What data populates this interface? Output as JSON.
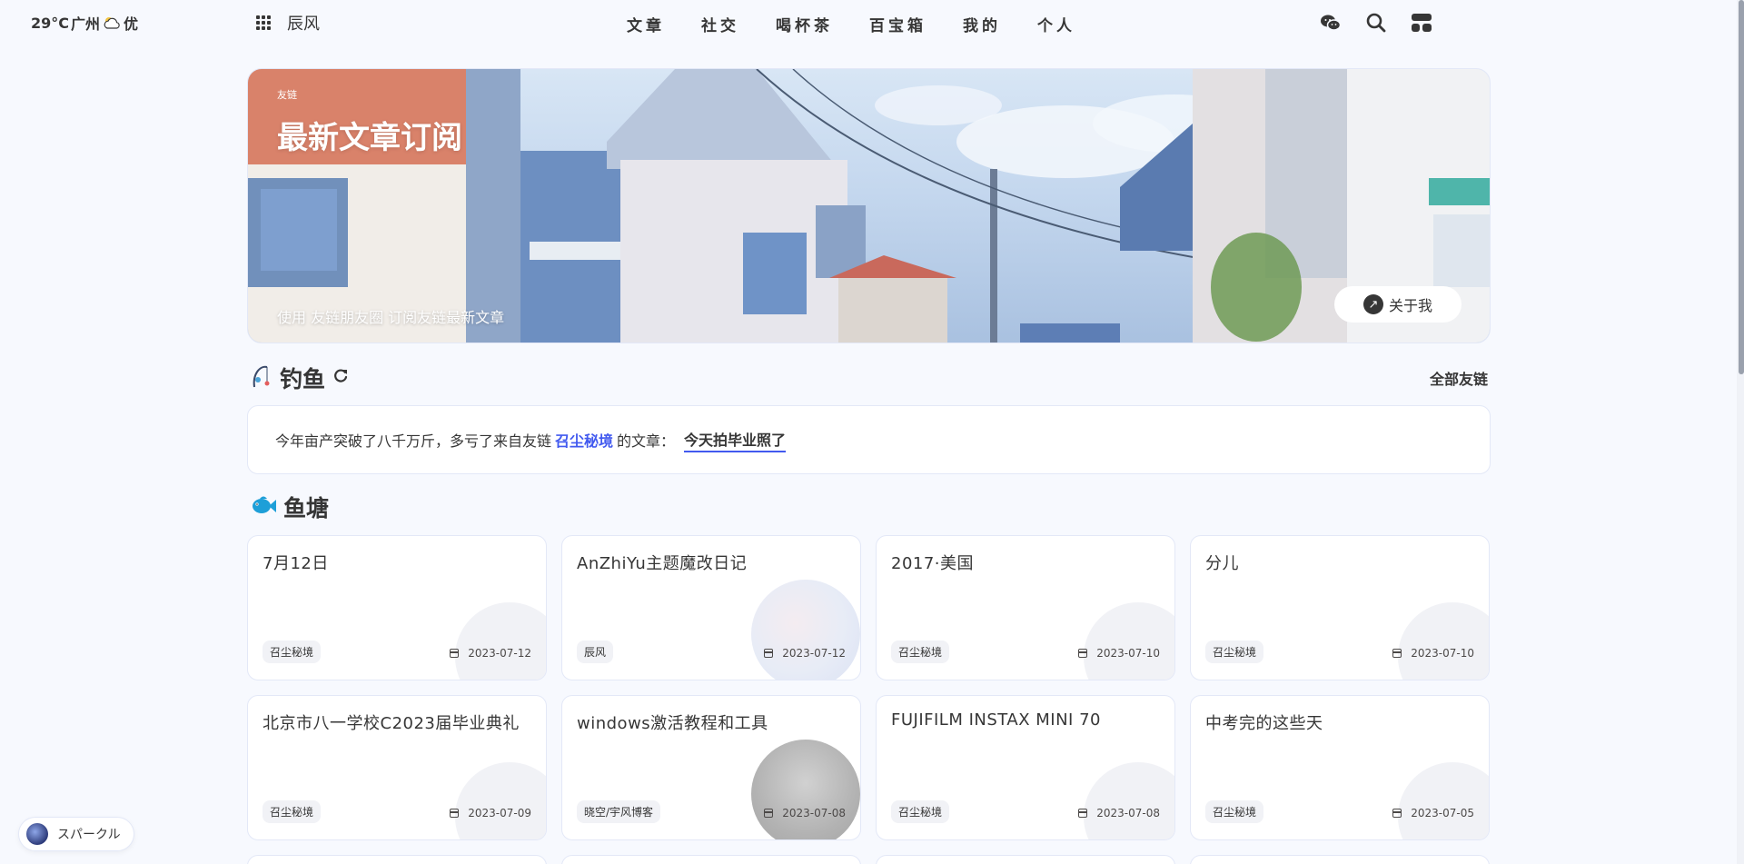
{
  "weather": {
    "temp": "29°C",
    "city": "广州",
    "aqi": "优"
  },
  "site": {
    "name": "辰风"
  },
  "nav": [
    {
      "label": "文章"
    },
    {
      "label": "社交"
    },
    {
      "label": "喝杯茶"
    },
    {
      "label": "百宝箱"
    },
    {
      "label": "我的"
    },
    {
      "label": "个人"
    }
  ],
  "nav_icons": [
    "wechat-icon",
    "search-icon",
    "layout-toggle-icon"
  ],
  "banner": {
    "tag": "友链",
    "title": "最新文章订阅",
    "description": "使用 友链朋友圈 订阅友链最新文章",
    "about_label": "关于我"
  },
  "fishing": {
    "heading": "钓鱼",
    "all_links": "全部友链",
    "text_before": "今年亩产突破了八千万斤，多亏了来自友链",
    "blog_name": "召尘秘境",
    "text_middle": "的文章：",
    "post_title": "今天拍毕业照了"
  },
  "pond": {
    "heading": "鱼塘",
    "cards": [
      {
        "title": "7月12日",
        "author": "召尘秘境",
        "date": "2023-07-12"
      },
      {
        "title": "AnZhiYu主题魔改日记",
        "author": "辰风",
        "date": "2023-07-12"
      },
      {
        "title": "2017·美国",
        "author": "召尘秘境",
        "date": "2023-07-10"
      },
      {
        "title": "分儿",
        "author": "召尘秘境",
        "date": "2023-07-10"
      },
      {
        "title": "北京市八一学校C2023届毕业典礼",
        "author": "召尘秘境",
        "date": "2023-07-09"
      },
      {
        "title": "windows激活教程和工具",
        "author": "晓空/宇风博客",
        "date": "2023-07-08"
      },
      {
        "title": "FUJIFILM INSTAX MINI 70",
        "author": "召尘秘境",
        "date": "2023-07-08"
      },
      {
        "title": "中考完的这些天",
        "author": "召尘秘境",
        "date": "2023-07-05"
      }
    ]
  },
  "music": {
    "title": "スパークル"
  },
  "colors": {
    "accent": "#425aef",
    "background": "#f7f9fe",
    "text": "#363636"
  }
}
